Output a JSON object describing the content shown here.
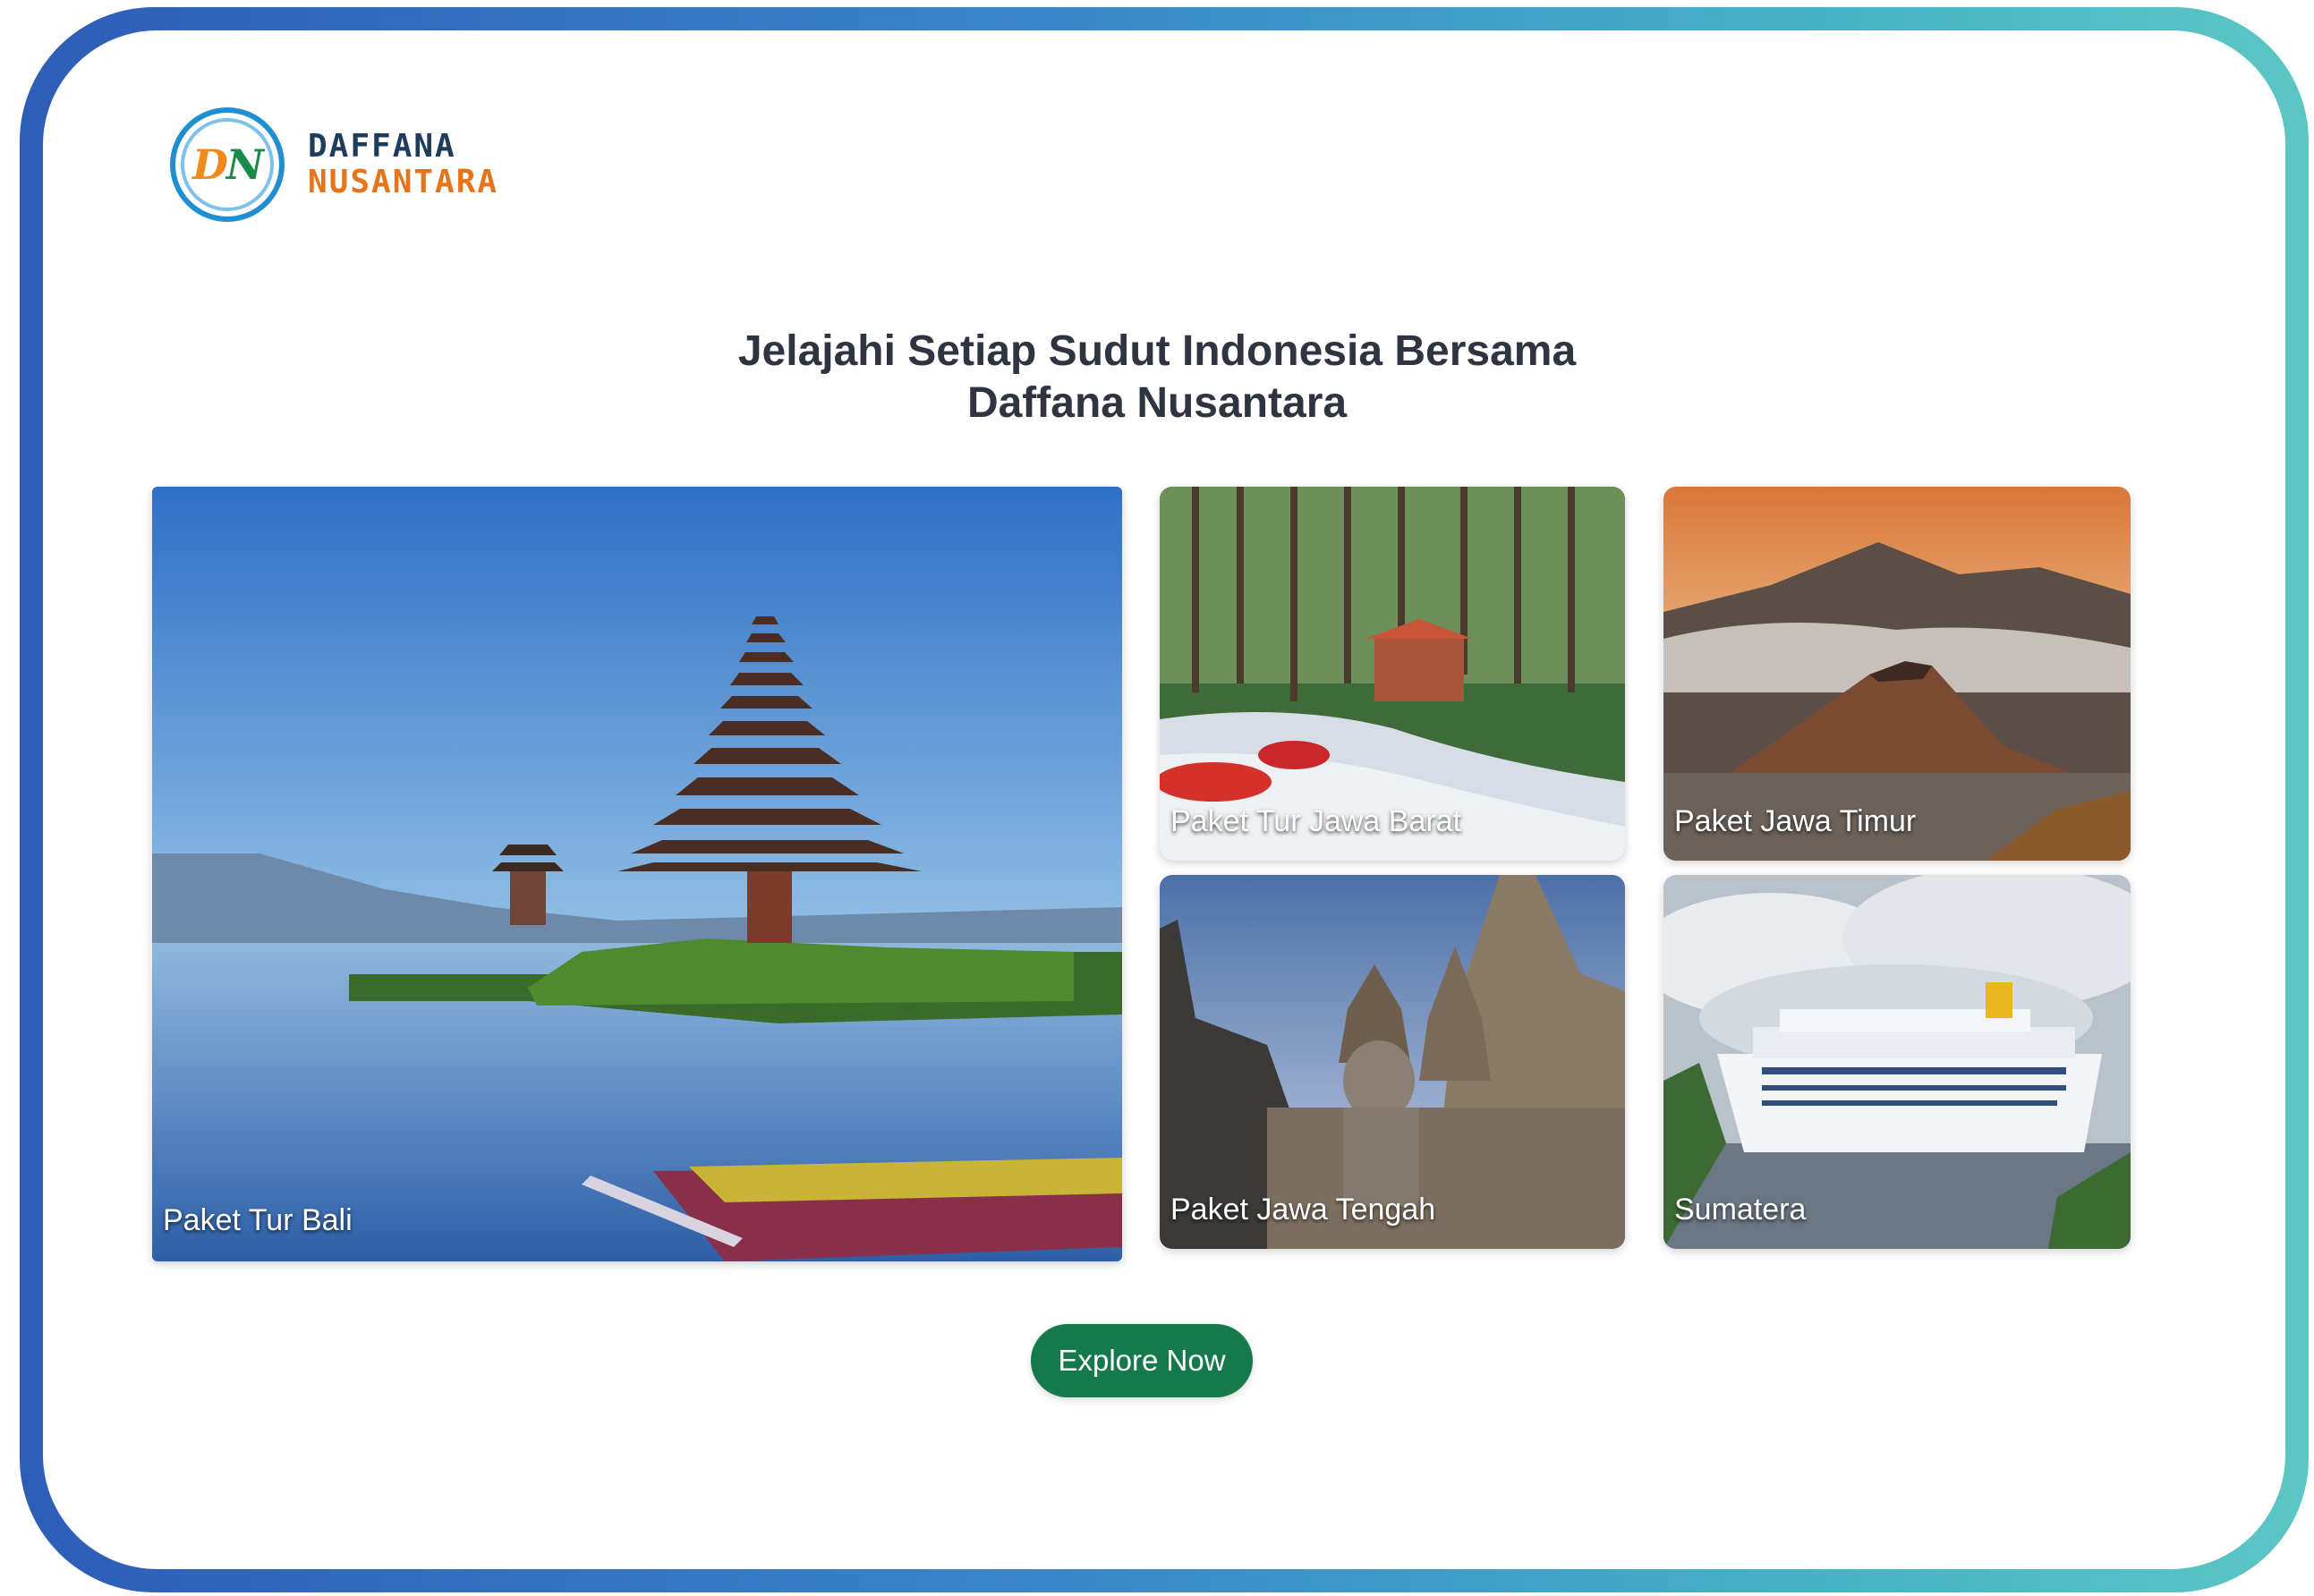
{
  "brand": {
    "line1": "DAFFANA",
    "line2": "NUSANTARA",
    "mark_d": "D",
    "mark_n": "N",
    "badge_color": "#1f8fd0",
    "line1_color": "#1e3d5c",
    "line2_color": "#e8741a"
  },
  "hero": {
    "line1": "Jelajahi Setiap Sudut Indonesia Bersama",
    "line2": "Daffana Nusantara"
  },
  "packages": [
    {
      "label": "Paket Tur Bali",
      "image": "bali-temple-lake"
    },
    {
      "label": "Paket Tur Jawa Barat",
      "image": "river-rafting-forest"
    },
    {
      "label": "Paket Jawa Timur",
      "image": "bromo-volcano"
    },
    {
      "label": "Paket Jawa Tengah",
      "image": "borobudur-temple"
    },
    {
      "label": "Sumatera",
      "image": "cruise-ship"
    }
  ],
  "cta": {
    "label": "Explore Now",
    "color": "#15794b"
  },
  "frame_gradient": [
    "#2e5db6",
    "#5cc6c4"
  ]
}
